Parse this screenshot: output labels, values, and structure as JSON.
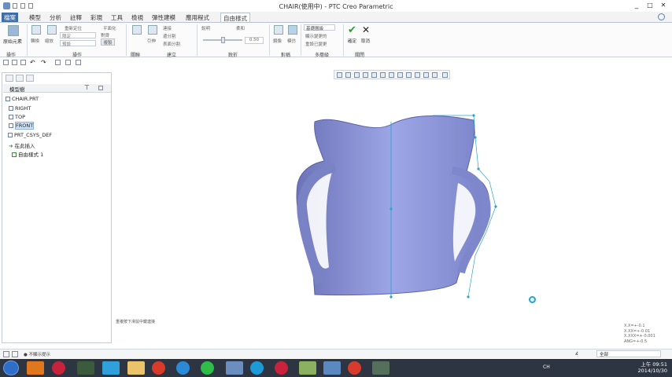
{
  "window": {
    "title": "CHAIR(使用中) - PTC Creo Parametric"
  },
  "tabs": [
    "檔案",
    "模型",
    "分析",
    "註釋",
    "彩現",
    "工具",
    "檢視",
    "彈性建模",
    "應用程式",
    "自由樣式"
  ],
  "ribbon": {
    "groups": [
      "操作",
      "操作",
      "關聯",
      "建立",
      "銳折",
      "對稱",
      "多層級",
      "關閉"
    ],
    "buttons": {
      "start": "原始元素",
      "select": "轉換",
      "scale": "縮放",
      "rebind": "重新定位",
      "planar": "平面化",
      "align": "對齊",
      "duplicate": "複製",
      "extrude": "引伸",
      "merge": "連接",
      "split": "邊分割",
      "facesplit": "表面分割",
      "sharpen": "銳明",
      "soften": "柔和",
      "sharp_value": "0.50",
      "mirror": "鏡像",
      "mode": "模仿",
      "level": "基礎層級",
      "show_changes": "顯示變更的",
      "reset_changes": "重設已變更",
      "ok": "確定",
      "cancel": "取消"
    },
    "dropdowns": {
      "scope": "限定",
      "preset": "預設"
    }
  },
  "model_tree": {
    "title": "模型樹",
    "items": [
      "CHAIR.PRT",
      "RIGHT",
      "TOP",
      "FRONT",
      "PRT_CSYS_DEF",
      "在此插入",
      "自由樣式 1"
    ]
  },
  "status_text": "重複按下滑鼠中鍵連接",
  "coords": [
    "X.X=+-0.1",
    "X.XX=+-0.01",
    "X.XXX=+-0.001",
    "ANG=+-0.5"
  ],
  "bottom": {
    "note": "● 不顯示提示",
    "filter": "全部"
  },
  "taskbar": {
    "lang": "CH",
    "time": "上午 09:51",
    "date": "2014/10/30"
  }
}
